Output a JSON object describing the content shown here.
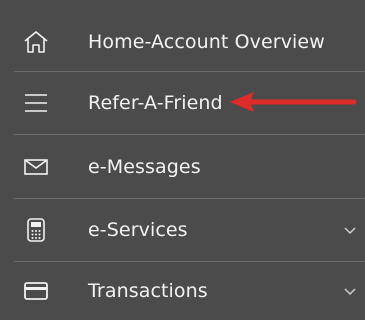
{
  "menu": {
    "items": [
      {
        "label": "Home-Account Overview",
        "icon": "home-icon",
        "has_chevron": false
      },
      {
        "label": "Refer-A-Friend",
        "icon": "hamburger-menu-icon",
        "has_chevron": false
      },
      {
        "label": "e-Messages",
        "icon": "envelope-icon",
        "has_chevron": false
      },
      {
        "label": "e-Services",
        "icon": "calculator-icon",
        "has_chevron": true
      },
      {
        "label": "Transactions",
        "icon": "credit-card-icon",
        "has_chevron": true
      }
    ]
  },
  "colors": {
    "background": "#4a4b4a",
    "text": "#f2f2f2",
    "divider": "#6a6b6a",
    "annotation_arrow": "#e02b2b"
  }
}
